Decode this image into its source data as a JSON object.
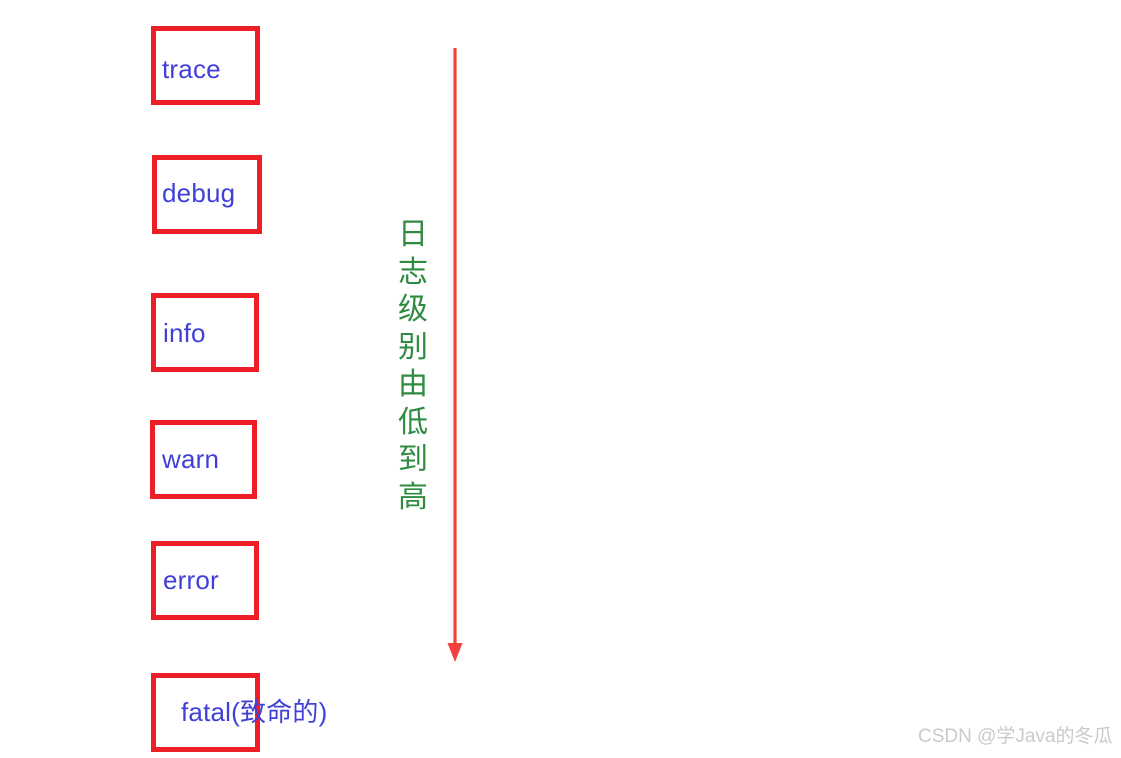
{
  "diagram": {
    "title": "Log level hierarchy diagram",
    "colors": {
      "box_border": "#ec1f27",
      "box_label_text": "#4040d8",
      "arrow": "#f5413d",
      "annotation_text": "#2f8b3f",
      "watermark_text": "#c9cacc",
      "background": "#ffffff"
    },
    "levels": [
      {
        "id": "trace",
        "label": "trace"
      },
      {
        "id": "debug",
        "label": "debug"
      },
      {
        "id": "info",
        "label": "info"
      },
      {
        "id": "warn",
        "label": "warn"
      },
      {
        "id": "error",
        "label": "error"
      },
      {
        "id": "fatal",
        "label": "fatal(致命的)"
      }
    ],
    "annotation": {
      "text": "日志级别由低到高",
      "characters": [
        "日",
        "志",
        "级",
        "别",
        "由",
        "低",
        "到",
        "高"
      ],
      "orientation": "vertical-top-to-bottom",
      "meaning_note": "日志级别由低到高"
    },
    "arrow": {
      "direction": "down",
      "label": ""
    }
  },
  "watermark": {
    "text": "CSDN @学Java的冬瓜"
  }
}
